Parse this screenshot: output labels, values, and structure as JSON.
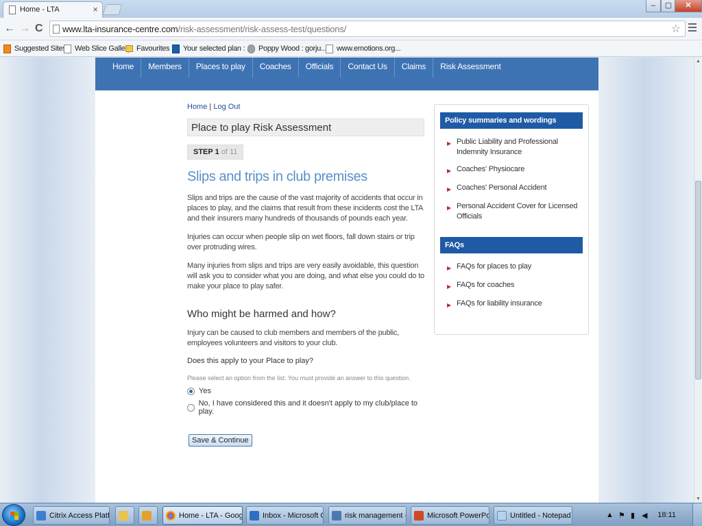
{
  "browser": {
    "tab_title": "Home - LTA",
    "tab_close": "×",
    "window_buttons": {
      "minimize": "–",
      "maximize": "▢",
      "close": "✕"
    },
    "nav": {
      "back": "←",
      "forward": "→",
      "reload": "C"
    },
    "url_host": "www.lta-insurance-centre.com",
    "url_path": "/risk-assessment/risk-assess-test/questions/",
    "bookmarks": [
      "Suggested Sites",
      "Web Slice Gallery",
      "Favourites",
      "Your selected plan : ...",
      "Poppy Wood : gorju...",
      "www.emotions.org..."
    ]
  },
  "site": {
    "nav": [
      "Home",
      "Members",
      "Places to play",
      "Coaches",
      "Officials",
      "Contact Us",
      "Claims",
      "Risk Assessment"
    ],
    "breadcrumb": {
      "home": "Home",
      "sep": "|",
      "logout": "Log Out"
    },
    "page_title": "Place to play Risk Assessment",
    "step": {
      "label": "STEP 1",
      "of": " of 11"
    },
    "heading": "Slips and trips in club premises",
    "paragraphs": [
      "Slips and trips are the cause of the vast majority of accidents that occur in places to play, and the claims that result from these incidents cost the LTA and their insurers many hundreds of thousands of pounds each year.",
      "Injuries can occur when people slip on wet floors, fall down stairs or trip over protruding wires.",
      "Many injuries from slips and trips are very easily avoidable, this question will ask you to consider what you are doing, and what else you could do to make your place to play safer."
    ],
    "subheading": "Who might be harmed and how?",
    "harm_text": "Injury can be caused to club members and members of the public, employees volunteers and visitors to your club.",
    "question": "Does this apply to your Place to play?",
    "hint": "Please select an option from the list. You must provide an answer to this question.",
    "options": [
      {
        "label": "Yes",
        "selected": true
      },
      {
        "label": "No, I have considered this and it doesn't apply to my club/place to play.",
        "selected": false
      }
    ],
    "submit": "Save & Continue",
    "sidebar": {
      "policy_heading": "Policy summaries and wordings",
      "policy_items": [
        "Public Liability and Professional Indemnity Insurance",
        "Coaches' Physiocare",
        "Coaches' Personal Accident",
        "Personal Accident Cover for Licensed Officials"
      ],
      "faq_heading": "FAQs",
      "faq_items": [
        "FAQs for places to play",
        "FAQs for coaches",
        "FAQs for liability insurance"
      ]
    }
  },
  "taskbar": {
    "tasks": [
      "Citrix Access Platfor...",
      "",
      "",
      "Home - LTA - Goog...",
      "Inbox - Microsoft Ou...",
      "risk management - \\...",
      "Microsoft PowerPoin...",
      "Untitled - Notepad"
    ],
    "clock": "18:11"
  },
  "colors": {
    "nav_blue": "#3e73b3",
    "heading_blue": "#5a8fc9",
    "sidebar_head": "#1f5aa5",
    "arrow_red": "#c0292a"
  }
}
